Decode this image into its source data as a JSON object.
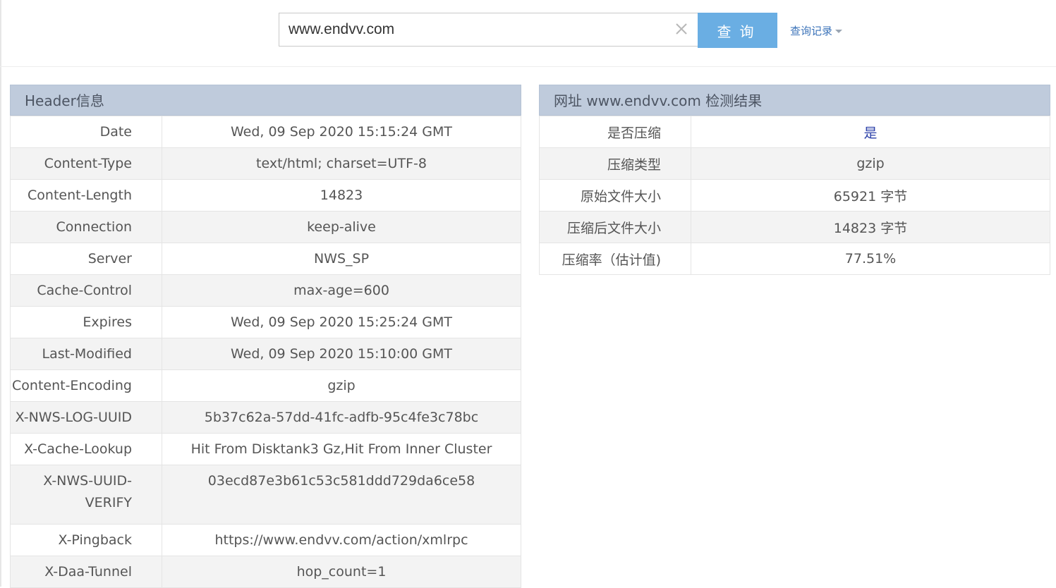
{
  "search": {
    "value": "www.endvv.com",
    "button_label": "查询",
    "history_label": "查询记录"
  },
  "header_panel": {
    "title": "Header信息",
    "rows": [
      {
        "key": "Date",
        "value": "Wed, 09 Sep 2020 15:15:24 GMT"
      },
      {
        "key": "Content-Type",
        "value": "text/html; charset=UTF-8"
      },
      {
        "key": "Content-Length",
        "value": "14823"
      },
      {
        "key": "Connection",
        "value": "keep-alive"
      },
      {
        "key": "Server",
        "value": "NWS_SP"
      },
      {
        "key": "Cache-Control",
        "value": "max-age=600"
      },
      {
        "key": "Expires",
        "value": "Wed, 09 Sep 2020 15:25:24 GMT"
      },
      {
        "key": "Last-Modified",
        "value": "Wed, 09 Sep 2020 15:10:00 GMT"
      },
      {
        "key": "Content-Encoding",
        "value": "gzip"
      },
      {
        "key": "X-NWS-LOG-UUID",
        "value": "5b37c62a-57dd-41fc-adfb-95c4fe3c78bc"
      },
      {
        "key": "X-Cache-Lookup",
        "value": "Hit From Disktank3 Gz,Hit From Inner Cluster"
      },
      {
        "key": "X-NWS-UUID-VERIFY",
        "value": "03ecd87e3b61c53c581ddd729da6ce58"
      },
      {
        "key": "X-Pingback",
        "value": "https://www.endvv.com/action/xmlrpc"
      },
      {
        "key": "X-Daa-Tunnel",
        "value": "hop_count=1"
      }
    ]
  },
  "result_panel": {
    "title": "网址 www.endvv.com 检测结果",
    "rows": [
      {
        "key": "是否压缩",
        "value": "是"
      },
      {
        "key": "压缩类型",
        "value": "gzip"
      },
      {
        "key": "原始文件大小",
        "value": "65921 字节"
      },
      {
        "key": "压缩后文件大小",
        "value": "14823 字节"
      },
      {
        "key": "压缩率（估计值)",
        "value": "77.51%"
      }
    ]
  },
  "colors": {
    "button": "#6aaee3",
    "panel_header": "#bfcbdc",
    "link": "#3b73b9",
    "highlight_value": "#2a3fa8"
  },
  "icons": {
    "clear": "close-icon",
    "dropdown": "caret-down-icon"
  }
}
